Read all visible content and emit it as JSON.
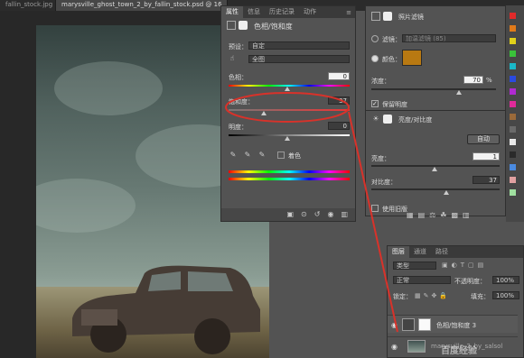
{
  "doc_tabs": [
    "fallin_stock.jpg",
    "marysville_ghost_town_2_by_fallin_stock.psd @ 16"
  ],
  "properties": {
    "tabs": [
      "属性",
      "信息",
      "历史记录",
      "动作"
    ],
    "title": "色相/饱和度",
    "preset_label": "预设：",
    "preset_value": "自定",
    "channel_value": "全图",
    "hue_label": "色相：",
    "hue_value": "0",
    "hue_level": 0.5,
    "saturation_label": "饱和度：",
    "saturation_value": "37",
    "saturation_level": 0.32,
    "lightness_label": "明度：",
    "lightness_value": "0",
    "lightness_level": 0.5,
    "colorize_label": "着色"
  },
  "photo_filter": {
    "title": "照片滤镜",
    "filter_label": "滤镜：",
    "filter_value": "加温滤镜 (85)",
    "color_label": "颜色：",
    "color_hex": "#b87912",
    "density_label": "浓度：",
    "density_value": "70",
    "density_unit": "%",
    "density_level": 0.7,
    "preserve_label": "保留明度"
  },
  "brightness": {
    "title": "亮度/对比度",
    "auto_label": "自动",
    "brightness_label": "亮度：",
    "brightness_value": "1",
    "brightness_level": 0.5,
    "contrast_label": "对比度：",
    "contrast_value": "37",
    "contrast_level": 0.6,
    "legacy_label": "使用旧版"
  },
  "layers": {
    "tabs": [
      "图层",
      "通道",
      "路径"
    ],
    "filter_kind": "类型",
    "blend_mode": "正常",
    "opacity_label": "不透明度：",
    "opacity_value": "100%",
    "lock_label": "锁定：",
    "fill_label": "填充：",
    "fill_value": "100%",
    "rows": [
      "色相/饱和度 3",
      "marysville_2_by_salsol"
    ]
  },
  "annotation_color": "#d8322a",
  "watermark": "百度经验"
}
